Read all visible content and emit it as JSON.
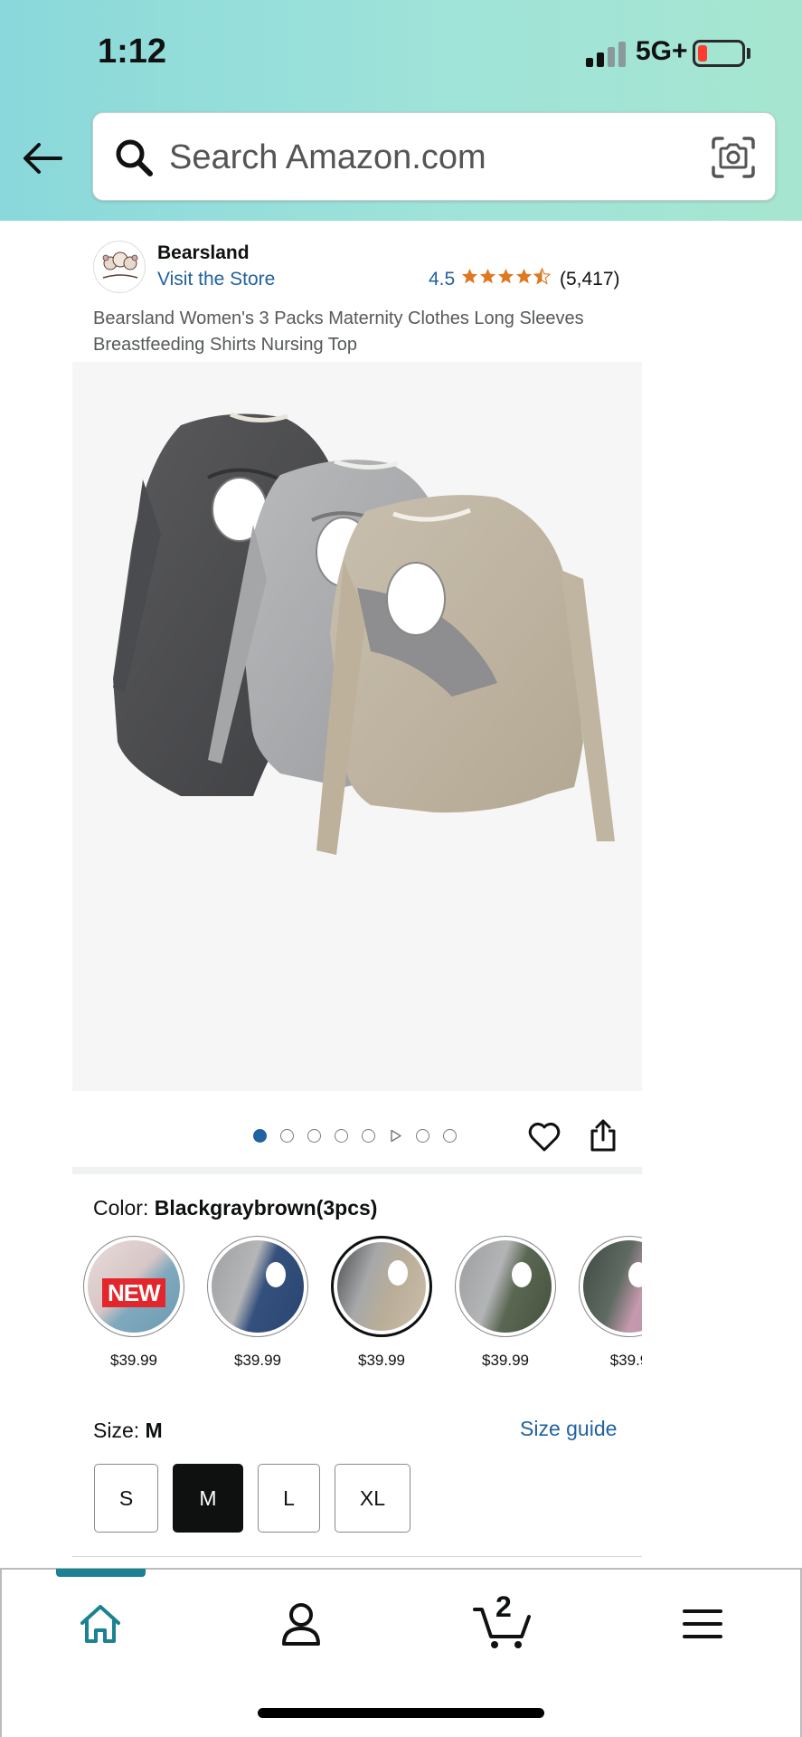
{
  "status_bar": {
    "time": "1:12",
    "network": "5G+",
    "battery_level": 0.1,
    "battery_color": "#ff3b30"
  },
  "search": {
    "placeholder": "Search Amazon.com",
    "back_icon": "arrow-left-icon",
    "search_icon": "magnifier-icon",
    "camera_icon": "camera-scan-icon"
  },
  "store": {
    "name": "Bearsland",
    "visit_label": "Visit the Store",
    "rating": "4.5",
    "stars": 4.5,
    "rating_count": "(5,417)",
    "star_color": "#de7921",
    "link_color": "#2162a1"
  },
  "product": {
    "title": "Bearsland Women's 3 Packs Maternity Clothes Long Sleeves Breastfeeding Shirts Nursing Top",
    "image_count": 8,
    "active_image": 1
  },
  "color": {
    "label": "Color:",
    "selected_value": "Blackgraybrown(3pcs)",
    "options": [
      {
        "price": "$39.99",
        "badge": "NEW"
      },
      {
        "price": "$39.99",
        "badge": ""
      },
      {
        "price": "$39.99",
        "badge": ""
      },
      {
        "price": "$39.99",
        "badge": ""
      },
      {
        "price": "$39.9",
        "badge": ""
      }
    ]
  },
  "size": {
    "label": "Size:",
    "selected_value": "M",
    "guide_label": "Size guide",
    "options": [
      "S",
      "M",
      "L",
      "XL"
    ]
  },
  "nav": {
    "cart_count": "2",
    "accent_color": "#1a8292",
    "items": [
      "home-icon",
      "account-icon",
      "cart-icon",
      "menu-icon"
    ]
  }
}
